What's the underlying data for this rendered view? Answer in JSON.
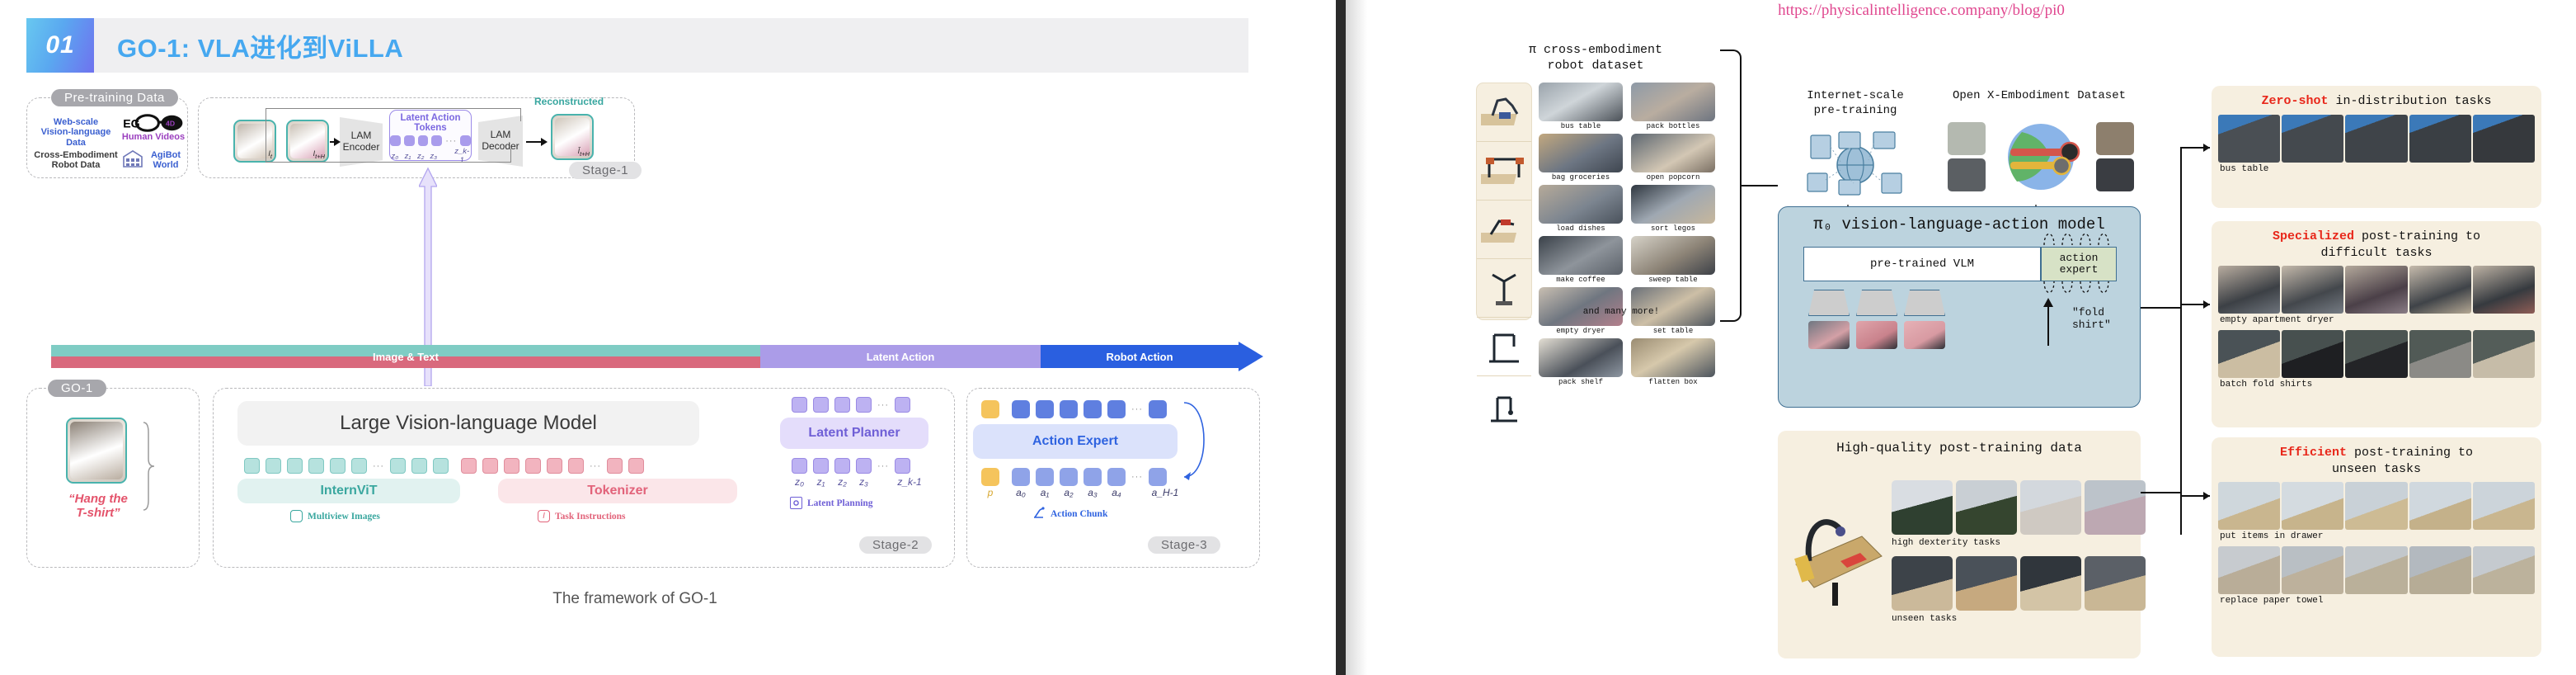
{
  "slide": {
    "number": "01",
    "title": "GO-1: VLA进化到ViLLA",
    "caption": "The framework of GO-1"
  },
  "framework": {
    "pretraining": {
      "tag": "Pre-training Data",
      "items": [
        "Web-scale Vision-language Data",
        "EGO4D Human Videos",
        "Cross-Embodiment Robot Data",
        "AgiBot World"
      ],
      "web_scale": "Web-scale\nVision-language\nData",
      "ego4d": "EGO4D",
      "human_videos": "Human Videos",
      "cross_embodiment": "Cross-Embodiment\nRobot Data",
      "agibot": "AgiBot\nWorld"
    },
    "stage1": {
      "tag": "Stage-1",
      "frame_t": "I_t",
      "frame_th": "I_t+H",
      "encoder": "LAM Encoder",
      "decoder": "LAM Decoder",
      "latent_tokens_title": "Latent Action Tokens",
      "z_labels": [
        "z₀",
        "z₁",
        "z₂",
        "z₃",
        "z_k-1"
      ],
      "reconstructed": "Reconstructed",
      "recon_label": "Î_t+H"
    },
    "arrowbar": {
      "segments": [
        "Image & Text",
        "Latent Action",
        "Robot Action"
      ],
      "colors": [
        "#7fccc4",
        "#d9697d",
        "#ab9ce8",
        "#2a5fe0"
      ]
    },
    "go1": {
      "tag": "GO-1",
      "instruction": "\"Hang the\nT-shirt\""
    },
    "vlm": {
      "title": "Large Vision-language Model",
      "internvit": "InternViT",
      "tokenizer": "Tokenizer",
      "legend_images": "Multiview Images",
      "legend_instructions": "Task Instructions"
    },
    "planner": {
      "title": "Latent Planner",
      "tag": "Stage-2",
      "z_labels": [
        "z₀",
        "z₁",
        "z₂",
        "z₃",
        "z_k-1"
      ],
      "legend": "Latent Planning"
    },
    "expert": {
      "title": "Action Expert",
      "tag": "Stage-3",
      "a_labels": [
        "p",
        "a₀",
        "a₁",
        "a₂",
        "a₃",
        "a₄",
        "a_H-1"
      ],
      "legend": "Action Chunk"
    }
  },
  "right_page": {
    "url": "https://physicalintelligence.company/blog/pi0",
    "dataset": {
      "title": "π cross-embodiment\nrobot dataset",
      "title_line1": "π cross-embodiment",
      "title_line2": "robot dataset",
      "thumbs": [
        "bus table",
        "pack bottles",
        "bag groceries",
        "open popcorn",
        "load dishes",
        "sort legos",
        "make coffee",
        "sweep table",
        "empty dryer",
        "set table",
        "pack shelf",
        "flatten box"
      ],
      "footer": "and many more!"
    },
    "internet": {
      "title_line1": "Internet-scale",
      "title_line2": "pre-training"
    },
    "oxe": {
      "title": "Open X-Embodiment Dataset"
    },
    "model": {
      "title": "π₀ vision-language-action model",
      "vlm": "pre-trained VLM",
      "expert_line1": "action",
      "expert_line2": "expert",
      "prompt": "\"fold shirt\""
    },
    "posttrain": {
      "title": "High-quality post-training data",
      "row1_caption": "high dexterity tasks",
      "row2_caption": "unseen tasks"
    },
    "results": [
      {
        "keyword": "Zero-shot",
        "rest": " in-distribution tasks",
        "rows": [
          {
            "caption": "bus table"
          }
        ]
      },
      {
        "keyword": "Specialized",
        "rest": " post-training to",
        "rest2": "difficult tasks",
        "rows": [
          {
            "caption": "empty apartment dryer"
          },
          {
            "caption": "batch fold shirts"
          }
        ]
      },
      {
        "keyword": "Efficient",
        "rest": " post-training to",
        "rest2": "unseen tasks",
        "rows": [
          {
            "caption": "put items in drawer"
          },
          {
            "caption": "replace paper towel"
          }
        ]
      }
    ]
  }
}
